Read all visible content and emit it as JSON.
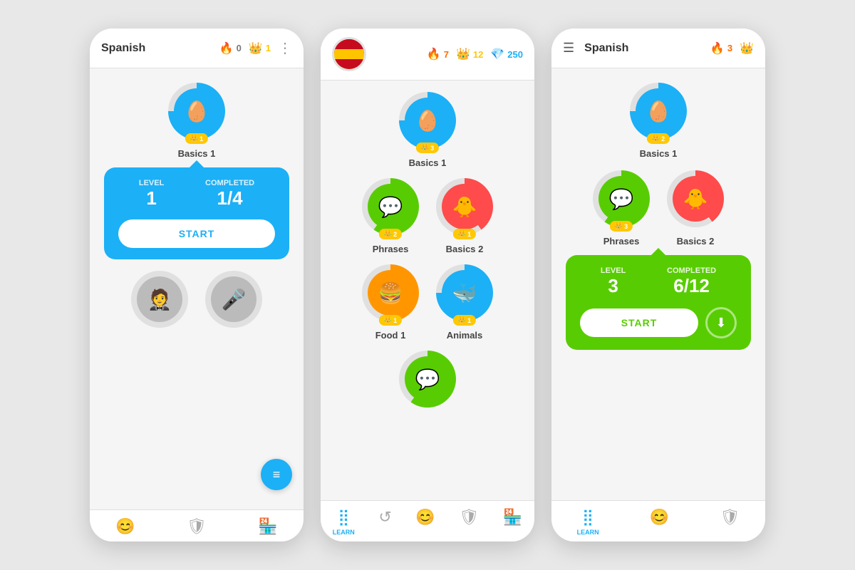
{
  "phones": [
    {
      "id": "phone1",
      "header": {
        "title": "Spanish",
        "fire": "0",
        "crown": "1",
        "show_dots": true,
        "show_flag": false
      },
      "lesson_basics1": {
        "label": "Basics 1",
        "badge": "1",
        "ring": "blue-ring",
        "icon": "🥚"
      },
      "popup": {
        "type": "blue",
        "level_label": "Level",
        "level_value": "1",
        "completed_label": "Completed",
        "completed_value": "1/4",
        "start_label": "START"
      },
      "locked_circles": [
        "🤵",
        "🎤"
      ],
      "bottom_nav": [
        {
          "icon": "😊",
          "label": "Profile",
          "active": false
        },
        {
          "icon": "🛡",
          "label": "Shield",
          "active": false
        },
        {
          "icon": "🏪",
          "label": "Shop",
          "active": false
        }
      ]
    },
    {
      "id": "phone2",
      "header": {
        "fire": "7",
        "crown": "12",
        "gem": "250",
        "show_flag": true
      },
      "lessons": [
        {
          "label": "Basics 1",
          "badge": "3",
          "ring": "blue-ring",
          "icon": "🥚",
          "row": 1
        },
        {
          "label": "Phrases",
          "badge": "2",
          "ring": "green-ring",
          "icon": "💬",
          "row": 2
        },
        {
          "label": "Basics 2",
          "badge": "1",
          "ring": "red-ring",
          "icon": "🐥",
          "row": 2
        },
        {
          "label": "Food 1",
          "badge": "1",
          "ring": "orange-ring",
          "icon": "🍔",
          "row": 3
        },
        {
          "label": "Animals",
          "badge": "1",
          "ring": "blue-ring",
          "icon": "🐳",
          "row": 3
        }
      ],
      "bottom_nav": [
        {
          "icon": "⣿",
          "label": "LEARN",
          "active": true
        },
        {
          "icon": "↺",
          "label": "",
          "active": false
        },
        {
          "icon": "😊",
          "label": "",
          "active": false
        },
        {
          "icon": "🛡",
          "label": "",
          "active": false
        },
        {
          "icon": "🏪",
          "label": "",
          "active": false
        }
      ]
    },
    {
      "id": "phone3",
      "header": {
        "title": "Spanish",
        "fire": "3",
        "crown": "",
        "show_hamburger": true
      },
      "lesson_basics1": {
        "label": "Basics 1",
        "badge": "2",
        "ring": "blue-ring",
        "icon": "🥚"
      },
      "lessons_row": [
        {
          "label": "Phrases",
          "badge": "3",
          "ring": "green-ring",
          "icon": "💬"
        },
        {
          "label": "Basics 2",
          "badge": "",
          "ring": "red-ring",
          "icon": "🐥"
        }
      ],
      "popup": {
        "type": "green",
        "level_label": "Level",
        "level_value": "3",
        "completed_label": "Completed",
        "completed_value": "6/12",
        "start_label": "START"
      },
      "bottom_nav": [
        {
          "icon": "⣿",
          "label": "Learn",
          "active": true
        },
        {
          "icon": "😊",
          "label": "",
          "active": false
        },
        {
          "icon": "🛡",
          "label": "",
          "active": false
        }
      ]
    }
  ]
}
